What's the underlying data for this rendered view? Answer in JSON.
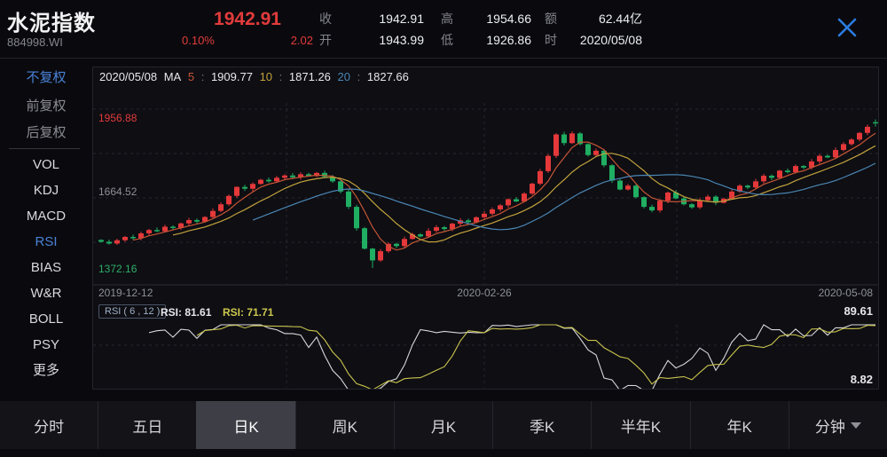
{
  "header": {
    "title": "水泥指数",
    "code": "884998.WI",
    "price": "1942.91",
    "change_pct": "0.10%",
    "change_val": "2.02",
    "price_color": "#e23b3b",
    "stats": [
      {
        "label": "收",
        "value": "1942.91"
      },
      {
        "label": "开",
        "value": "1943.99"
      },
      {
        "label": "高",
        "value": "1954.66"
      },
      {
        "label": "低",
        "value": "1926.86"
      },
      {
        "label": "额",
        "value": "62.44亿"
      },
      {
        "label": "时",
        "value": "2020/05/08"
      }
    ],
    "close_icon": "close-x",
    "close_color": "#2b7ce0"
  },
  "sidebar": {
    "items": [
      {
        "label": "不复权",
        "active": true,
        "group": "adjust"
      },
      {
        "label": "前复权",
        "active": false,
        "group": "adjust"
      },
      {
        "label": "后复权",
        "active": false,
        "group": "adjust"
      },
      {
        "label": "VOL",
        "active": false,
        "group": "indicator"
      },
      {
        "label": "KDJ",
        "active": false,
        "group": "indicator"
      },
      {
        "label": "MACD",
        "active": false,
        "group": "indicator"
      },
      {
        "label": "RSI",
        "active": true,
        "group": "indicator"
      },
      {
        "label": "BIAS",
        "active": false,
        "group": "indicator"
      },
      {
        "label": "W&R",
        "active": false,
        "group": "indicator"
      },
      {
        "label": "BOLL",
        "active": false,
        "group": "indicator"
      },
      {
        "label": "PSY",
        "active": false,
        "group": "indicator"
      },
      {
        "label": "更多",
        "active": false,
        "group": "indicator"
      }
    ],
    "active_color": "#4a82d6"
  },
  "chart": {
    "date": "2020/05/08",
    "ma_label": "MA",
    "ma_sep": ":",
    "ma": [
      {
        "period": "5",
        "value": "1909.77",
        "color": "#c55535"
      },
      {
        "period": "10",
        "value": "1871.26",
        "color": "#c2a23c"
      },
      {
        "period": "20",
        "value": "1827.66",
        "color": "#4b86b4"
      }
    ],
    "y_labels": {
      "top": "1956.88",
      "mid": "1664.52",
      "bottom": "1372.16"
    },
    "x_labels": {
      "left": "2019-12-12",
      "center": "2020-02-26",
      "right": "2020-05-08"
    },
    "rsi": {
      "box_label": "RSI ( 6 , 12 )",
      "v1": "RSI: 81.61",
      "v2": "RSI: 71.71",
      "max": "89.61",
      "min": "8.82",
      "line_colors": [
        "#d8d8dc",
        "#c9c34e"
      ]
    }
  },
  "tabs": [
    {
      "label": "分时",
      "active": false
    },
    {
      "label": "五日",
      "active": false
    },
    {
      "label": "日K",
      "active": true
    },
    {
      "label": "周K",
      "active": false
    },
    {
      "label": "月K",
      "active": false
    },
    {
      "label": "季K",
      "active": false
    },
    {
      "label": "半年K",
      "active": false
    },
    {
      "label": "年K",
      "active": false
    },
    {
      "label": "分钟",
      "active": false,
      "dropdown": true
    }
  ],
  "colors": {
    "up_red": "#e5383a",
    "down_green": "#1fae62",
    "grid": "#262630",
    "panel_bg": "#0e0e13"
  },
  "chart_data": {
    "type": "candlestick",
    "title": "水泥指数 884998.WI 日K 不复权 + RSI(6,12)",
    "first_open": 1482,
    "closes": [
      1475,
      1468,
      1481,
      1494,
      1489,
      1508,
      1521,
      1516,
      1534,
      1529,
      1547,
      1560,
      1554,
      1572,
      1596,
      1622,
      1655,
      1690,
      1683,
      1702,
      1718,
      1712,
      1726,
      1735,
      1728,
      1740,
      1733,
      1745,
      1730,
      1712,
      1672,
      1612,
      1528,
      1448,
      1402,
      1438,
      1467,
      1458,
      1486,
      1504,
      1496,
      1518,
      1532,
      1525,
      1546,
      1559,
      1552,
      1571,
      1585,
      1602,
      1618,
      1642,
      1633,
      1664,
      1703,
      1752,
      1812,
      1896,
      1862,
      1900,
      1858,
      1815,
      1832,
      1775,
      1715,
      1680,
      1695,
      1650,
      1612,
      1598,
      1636,
      1668,
      1645,
      1622,
      1610,
      1638,
      1652,
      1628,
      1644,
      1672,
      1695,
      1688,
      1712,
      1734,
      1726,
      1754,
      1748,
      1772,
      1766,
      1790,
      1812,
      1806,
      1835,
      1858,
      1876,
      1902,
      1926,
      1942.91
    ],
    "overrides": {
      "34": {
        "l": 1372.16
      },
      "97": {
        "o": 1943.99,
        "h": 1954.66,
        "l": 1926.86
      }
    },
    "last_day": {
      "open": 1943.99,
      "close": 1942.91,
      "high": 1954.66,
      "low": 1926.86,
      "amount": "62.44亿",
      "date": "2020/05/08",
      "change_pct": "0.10%",
      "change": "2.02"
    },
    "price_axis": {
      "top": 1956.88,
      "mid": 1664.52,
      "bottom": 1372.16
    },
    "x_axis_dates": [
      "2019-12-12",
      "2020-02-26",
      "2020-05-08"
    ],
    "ma_periods": [
      5,
      10,
      20
    ],
    "ma_last_values": [
      1909.77,
      1871.26,
      1827.66
    ],
    "rsi_periods": [
      6,
      12
    ],
    "rsi_last": [
      81.61,
      71.71
    ],
    "rsi_range": [
      8.82,
      89.61
    ]
  }
}
